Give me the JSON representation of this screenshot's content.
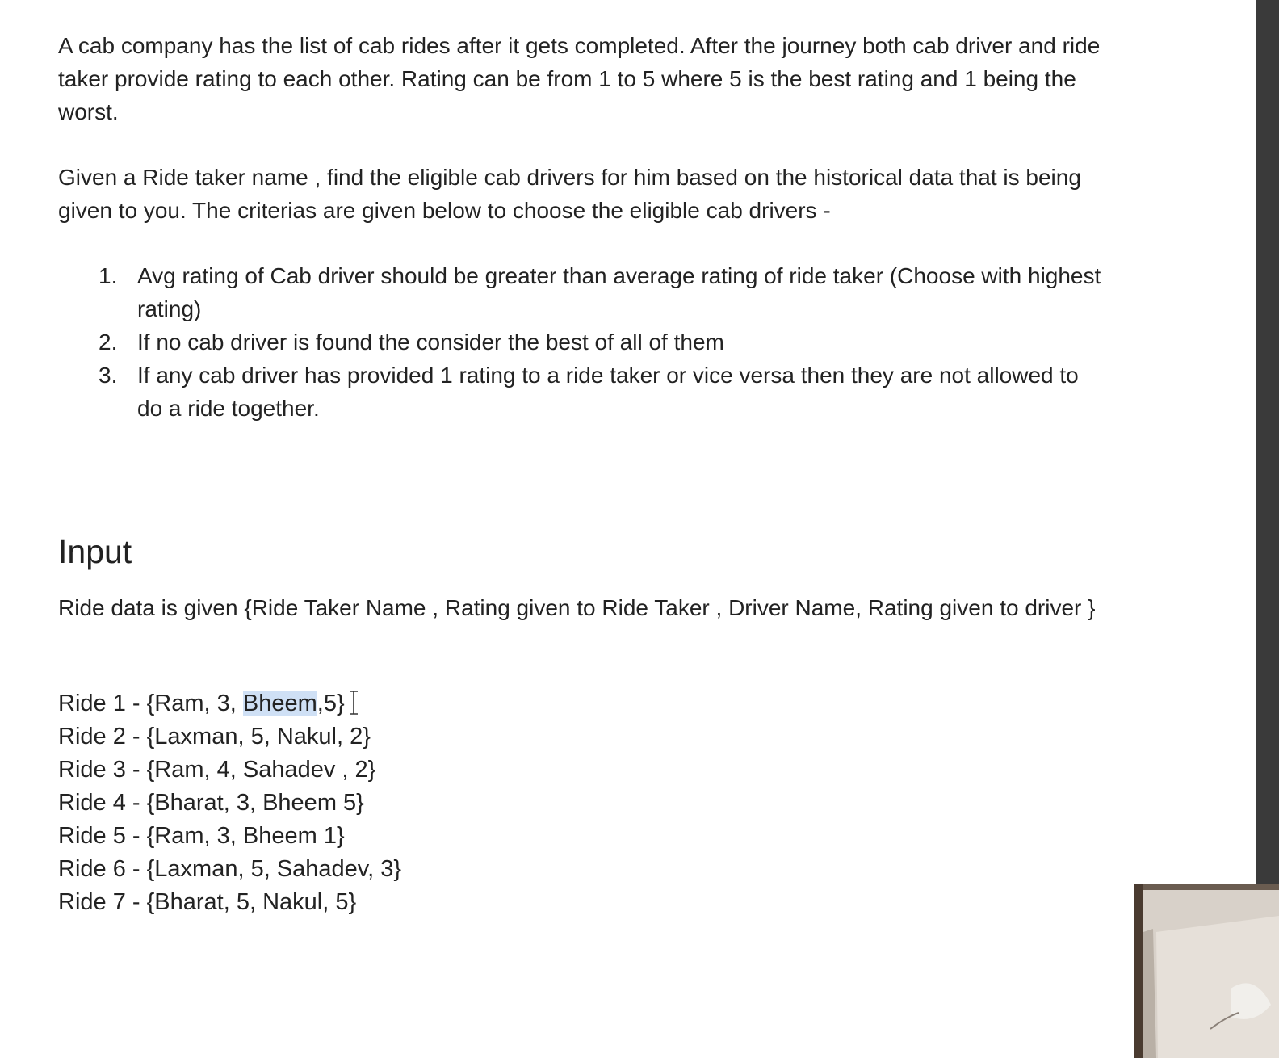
{
  "intro": {
    "paragraph1": "A cab company has the list of cab rides after it gets completed. After the journey both cab driver and ride taker provide rating to each other. Rating can be from 1 to 5 where 5 is the best rating and 1 being the worst.",
    "paragraph2": "Given a Ride taker name , find the eligible cab drivers for him based on the historical data that is being given to you. The criterias are given below to choose the eligible cab drivers -"
  },
  "criteria": [
    {
      "number": "1.",
      "text": "Avg rating of Cab driver should be greater than average rating of ride taker (Choose with highest rating)"
    },
    {
      "number": "2.",
      "text": "If no cab driver is found the consider the best of all of them"
    },
    {
      "number": "3.",
      "text": "If any cab driver has provided 1 rating to a ride taker or vice versa then they are not allowed to do a ride together."
    }
  ],
  "input": {
    "heading": "Input",
    "description": "Ride data is given {Ride Taker Name , Rating given to Ride Taker , Driver Name, Rating given to driver }"
  },
  "rides": {
    "ride1": {
      "before": "Ride 1 - {Ram, 3, ",
      "highlighted": "Bheem",
      "after": ",5}"
    },
    "ride2": "Ride 2 - {Laxman, 5, Nakul, 2}",
    "ride3": "Ride 3 - {Ram, 4, Sahadev , 2}",
    "ride4": "Ride 4 - {Bharat, 3, Bheem 5}",
    "ride5": "Ride 5 - {Ram, 3, Bheem 1}",
    "ride6": "Ride 6 - {Laxman, 5, Sahadev, 3}",
    "ride7": "Ride 7 - {Bharat, 5, Nakul, 5}"
  },
  "icons": {
    "text_cursor": "i-beam-cursor-icon"
  },
  "colors": {
    "text": "#222222",
    "selection_highlight": "#cfe0f5",
    "right_panel": "#3a3a3a"
  }
}
